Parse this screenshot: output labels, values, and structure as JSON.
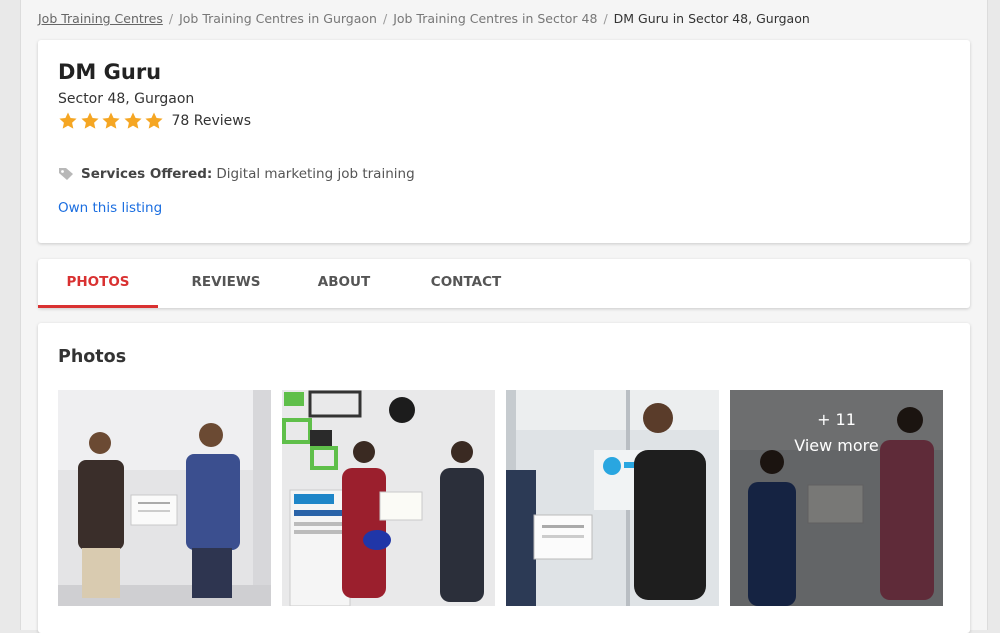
{
  "breadcrumb": {
    "items": [
      "Job Training Centres",
      "Job Training Centres in Gurgaon",
      "Job Training Centres in Sector 48",
      "DM Guru in Sector 48, Gurgaon"
    ],
    "separator": "/"
  },
  "business": {
    "name": "DM Guru",
    "location": "Sector 48, Gurgaon",
    "rating": 5,
    "reviews_label": "78 Reviews",
    "services_label": "Services Offered:",
    "services_value": "Digital marketing job training",
    "own_listing": "Own this listing"
  },
  "tabs": [
    {
      "label": "PHOTOS",
      "active": true
    },
    {
      "label": "REVIEWS",
      "active": false
    },
    {
      "label": "ABOUT",
      "active": false
    },
    {
      "label": "CONTACT",
      "active": false
    }
  ],
  "photos": {
    "title": "Photos",
    "more_count": "+ 11",
    "more_label": "View more"
  },
  "colors": {
    "accent": "#d93131",
    "link": "#1b6ee0",
    "star": "#f5a623"
  }
}
